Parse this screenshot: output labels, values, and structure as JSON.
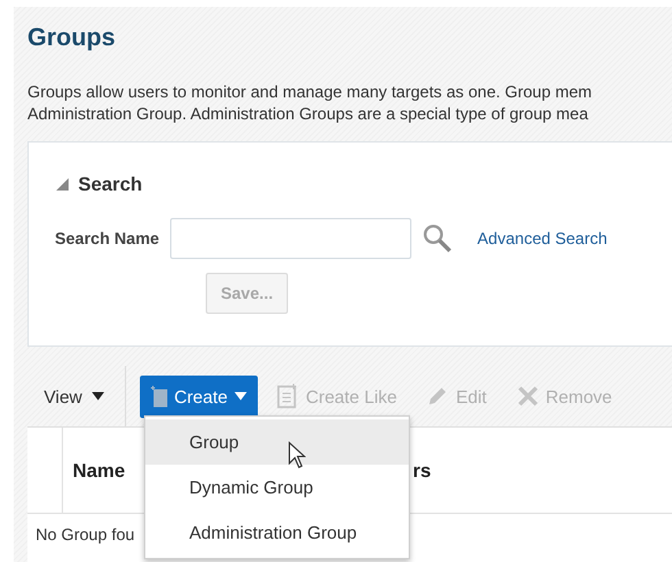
{
  "page": {
    "title": "Groups",
    "description_lines": [
      "Groups allow users to monitor and manage many targets as one. Group mem",
      "Administration Group. Administration Groups are a special type of group mea"
    ]
  },
  "search": {
    "title": "Search",
    "expanded": true,
    "label": "Search Name",
    "advanced_link": "Advanced Search",
    "save_button": {
      "label": "Save...",
      "disabled": true
    }
  },
  "toolbar": {
    "view_menu": "View",
    "buttons": [
      {
        "label": "Create",
        "kind": "primary",
        "disabled": false,
        "has_menu": true
      },
      {
        "label": "Create Like",
        "kind": "plain",
        "disabled": true,
        "has_menu": false
      },
      {
        "label": "Edit",
        "kind": "plain",
        "disabled": true,
        "has_menu": false
      },
      {
        "label": "Remove",
        "kind": "plain",
        "disabled": true,
        "has_menu": false
      }
    ]
  },
  "menu": {
    "items": [
      {
        "label": "Group",
        "selected": true
      },
      {
        "label": "Dynamic Group",
        "selected": false
      },
      {
        "label": "Administration Group",
        "selected": false
      }
    ]
  },
  "table": {
    "columns": [
      {
        "label": "Name"
      },
      {
        "label": "rs"
      }
    ],
    "empty_message": "No Group fou"
  }
}
